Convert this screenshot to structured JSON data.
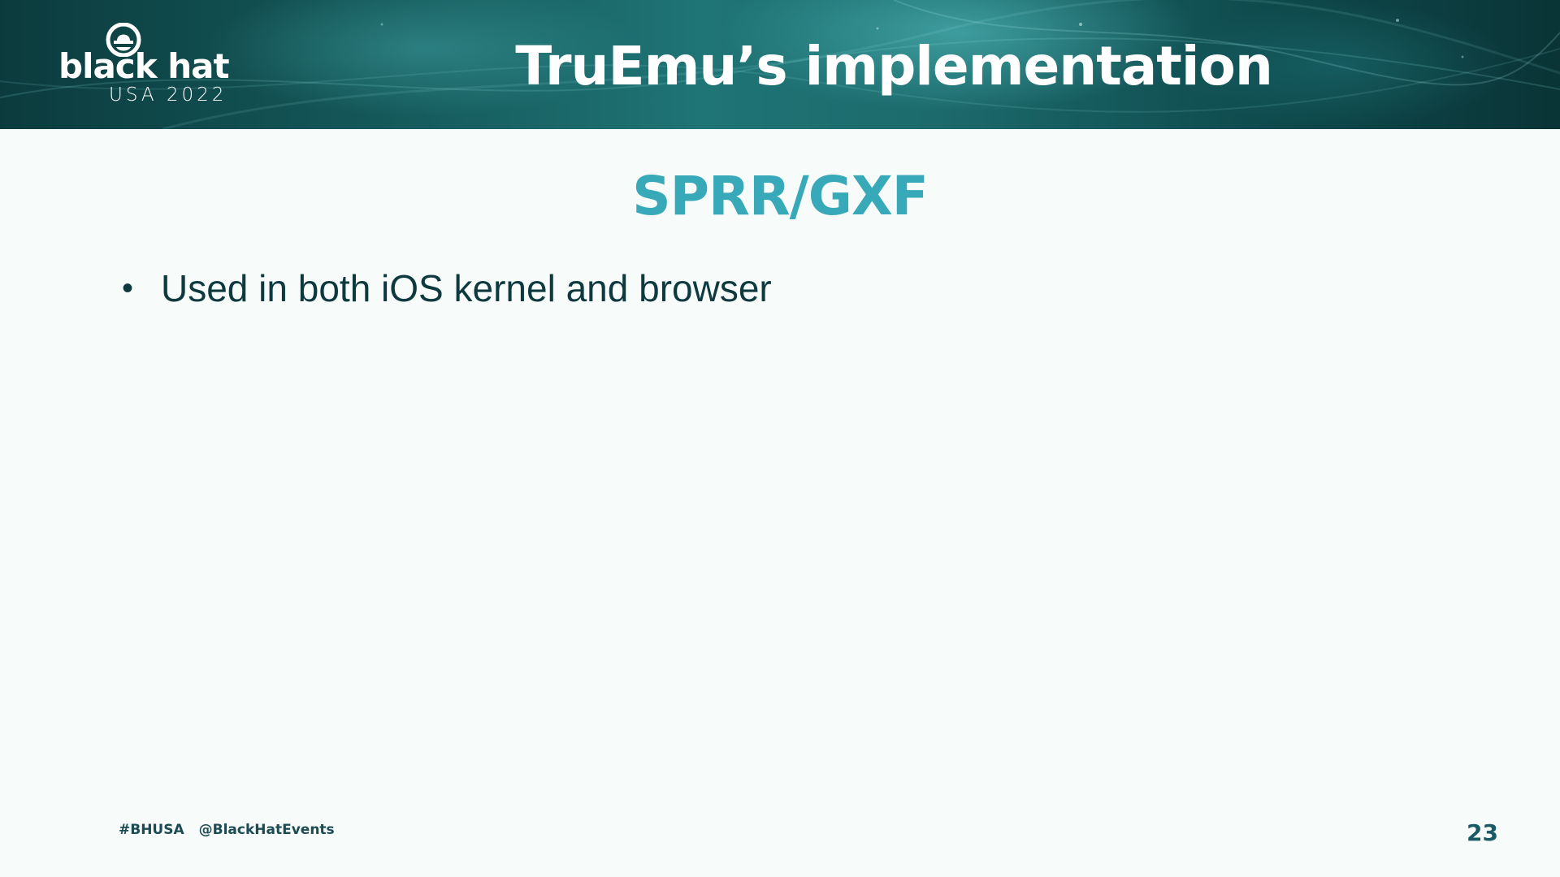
{
  "header": {
    "logo": {
      "brand": "black hat",
      "edition": "USA 2022"
    },
    "title": "TruEmu’s implementation"
  },
  "content": {
    "subtitle": "SPRR/GXF",
    "bullets": [
      "Used in both iOS kernel and browser"
    ],
    "bullet_marker": "•"
  },
  "footer": {
    "hashtag": "#BHUSA",
    "handle": "@BlackHatEvents",
    "page_number": "23"
  },
  "colors": {
    "header_dark": "#0b3b3d",
    "header_mid": "#1f7475",
    "subtitle_accent": "#38a9b8",
    "body_text": "#0e3a3f",
    "background": "#f7fbf9"
  }
}
